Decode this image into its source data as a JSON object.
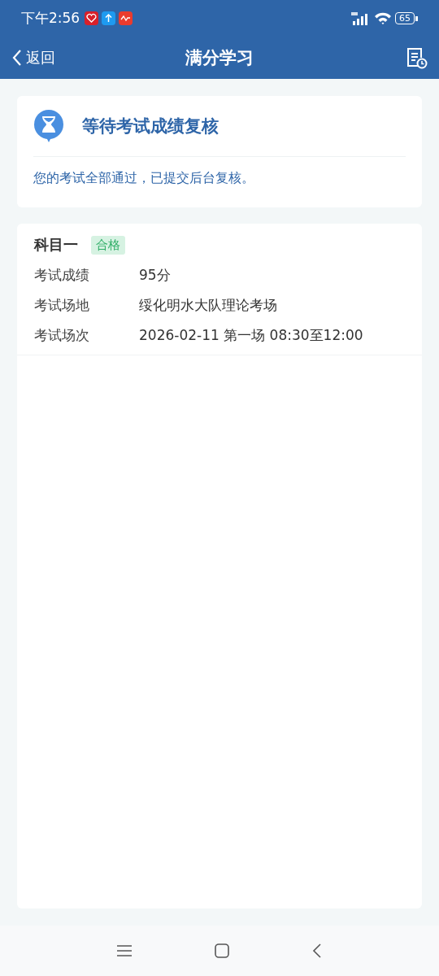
{
  "status_bar": {
    "time": "下午2:56",
    "battery": "65"
  },
  "nav": {
    "back": "返回",
    "title": "满分学习"
  },
  "status_card": {
    "title": "等待考试成绩复核",
    "message": "您的考试全部通过，已提交后台复核。"
  },
  "subject": {
    "name": "科目一",
    "badge": "合格",
    "passed": true,
    "rows": [
      {
        "label": "考试成绩",
        "value": "95分"
      },
      {
        "label": "考试场地",
        "value": "绥化明水大队理论考场"
      },
      {
        "label": "考试场次",
        "value": "2026-02-11 第一场 08:30至12:00"
      }
    ]
  }
}
